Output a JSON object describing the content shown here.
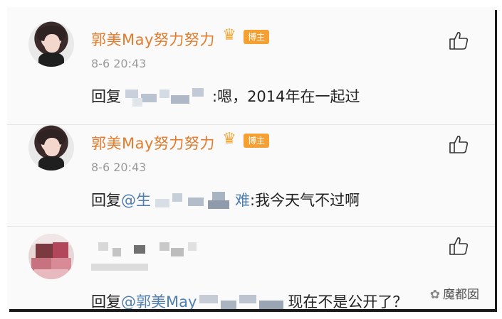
{
  "comments": [
    {
      "username": "郭美May努力努力",
      "badge": "博主",
      "time": "8-6 20:43",
      "reply_prefix": "回复",
      "reply_text": ":嗯，2014年在一起过"
    },
    {
      "username": "郭美May努力努力",
      "badge": "博主",
      "time": "8-6 20:43",
      "reply_prefix": "回复",
      "mention_start": "@生",
      "mention_end": "难",
      "reply_text": ":我今天气不过啊"
    },
    {
      "username": "",
      "time": "",
      "reply_prefix": "回复",
      "mention_start": "@郭美May",
      "reply_text": "现在不是公开了？"
    }
  ],
  "watermark": {
    "text": "魔都囡",
    "icon": "wechat-icon"
  },
  "colors": {
    "username": "#e27b2c",
    "badge": "#f6a033",
    "mention": "#4f7fb0"
  },
  "icons": {
    "like": "thumbs-up-icon",
    "crown": "crown-icon"
  }
}
